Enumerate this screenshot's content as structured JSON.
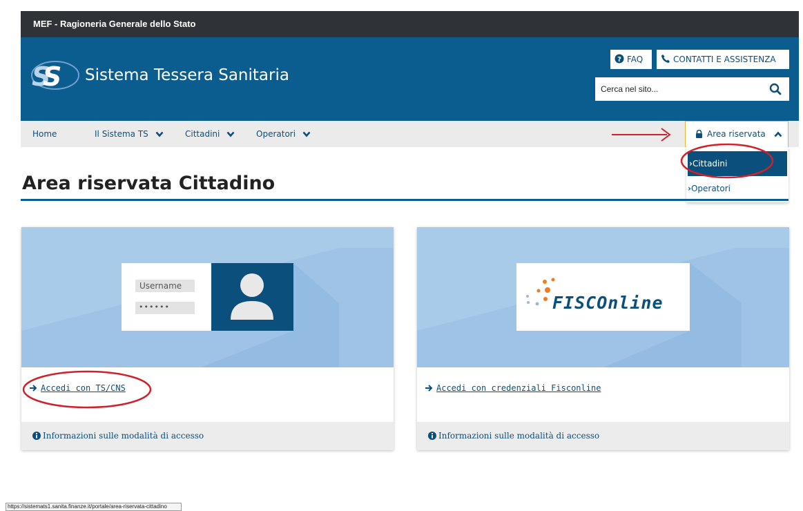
{
  "topbar": {
    "title": "MEF - Ragioneria Generale dello Stato"
  },
  "header": {
    "site_name": "Sistema Tessera Sanitaria",
    "faq_label": "FAQ",
    "contact_label": "CONTATTI E ASSISTENZA",
    "search_placeholder": "Cerca nel sito..."
  },
  "nav": {
    "items": [
      {
        "label": "Home"
      },
      {
        "label": "Il Sistema TS"
      },
      {
        "label": "Cittadini"
      },
      {
        "label": "Operatori"
      }
    ],
    "reserved_area": "Area riservata",
    "dropdown": [
      {
        "label": "Cittadini"
      },
      {
        "label": "Operatori"
      }
    ]
  },
  "page": {
    "title": "Area riservata Cittadino"
  },
  "cards": [
    {
      "username_label": "Username",
      "password_mask": "••••••",
      "link": "Accedi con TS/CNS",
      "info": "Informazioni sulle modalità di accesso"
    },
    {
      "logo_text": "FISCOnline",
      "link": "Accedi con credenziali Fisconline",
      "info": "Informazioni sulle modalità di accesso"
    }
  ],
  "status_bar": {
    "url": "https://sistemats1.sanita.finanze.it/portale/area-riservata-cittadino"
  },
  "colors": {
    "header_blue": "#0b5c8f",
    "link_blue": "#0b4f7c",
    "topbar": "#2f3236",
    "nav_bg": "#ebebeb",
    "card_img_bg": "#a9cbea",
    "annotation_red": "#d0202a",
    "fisconline_orange": "#f07b22"
  }
}
